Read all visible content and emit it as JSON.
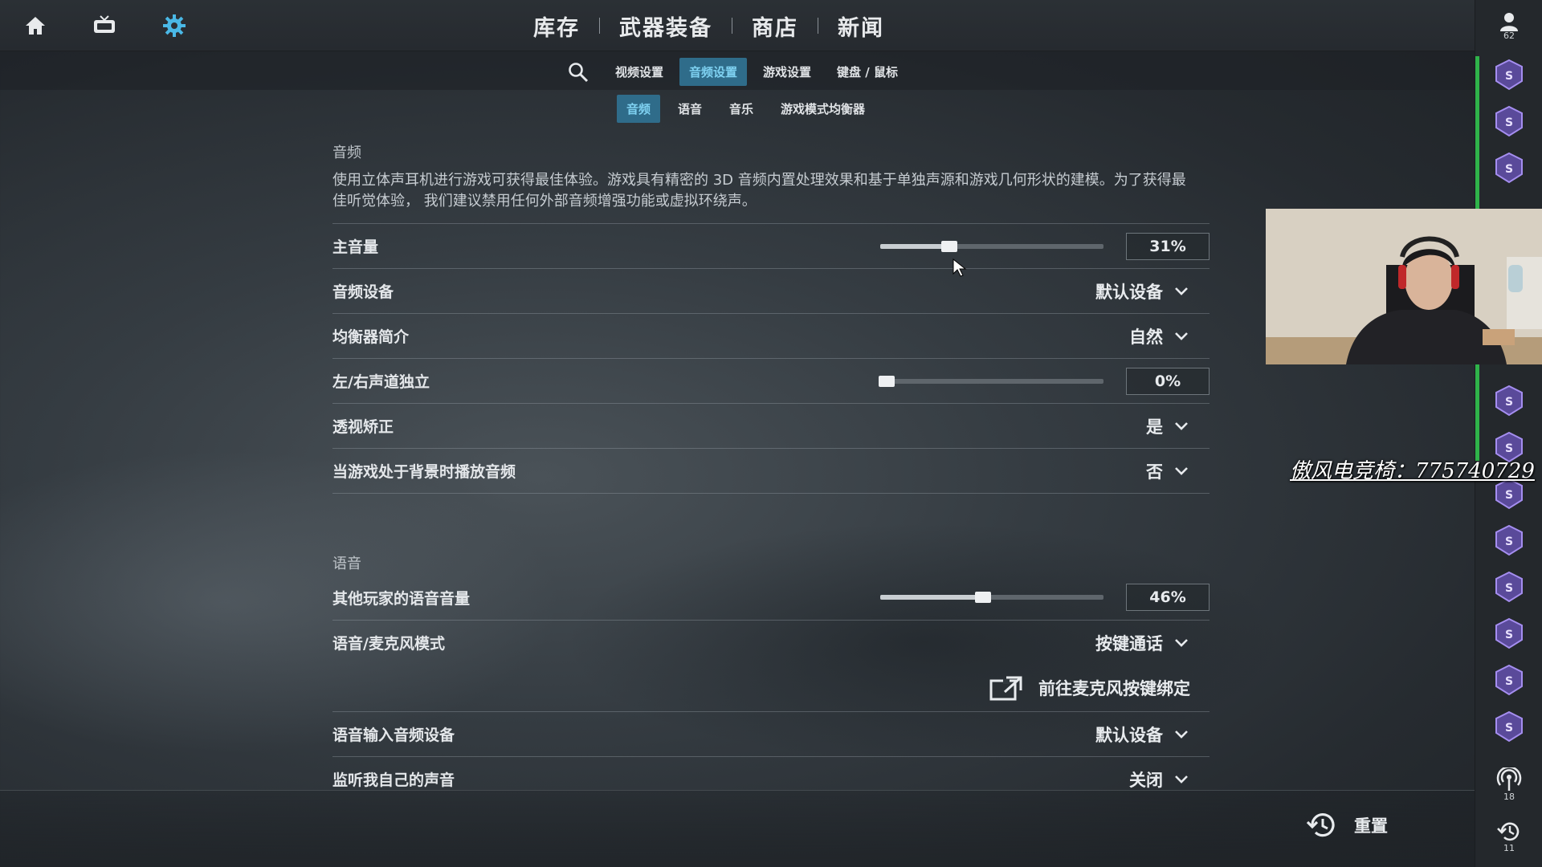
{
  "nav": {
    "main_tabs": [
      "库存",
      "武器装备",
      "商店",
      "新闻"
    ],
    "sub_tabs": [
      "视频设置",
      "音频设置",
      "游戏设置",
      "键盘 / 鼠标"
    ],
    "sub_active": "音频设置",
    "tertiary_tabs": [
      "音频",
      "语音",
      "音乐",
      "游戏模式均衡器"
    ],
    "tertiary_active": "音频"
  },
  "audio": {
    "section_title": "音频",
    "description": "使用立体声耳机进行游戏可获得最佳体验。游戏具有精密的 3D 音频内置处理效果和基于单独声源和游戏几何形状的建模。为了获得最佳听觉体验， 我们建议禁用任何外部音频增强功能或虚拟环绕声。",
    "master_volume": {
      "label": "主音量",
      "value": 31,
      "display": "31%"
    },
    "device": {
      "label": "音频设备",
      "value": "默认设备"
    },
    "eq_profile": {
      "label": "均衡器简介",
      "value": "自然"
    },
    "lr_isolation": {
      "label": "左/右声道独立",
      "value": 0,
      "display": "0%"
    },
    "perspective": {
      "label": "透视矫正",
      "value": "是"
    },
    "background_audio": {
      "label": "当游戏处于背景时播放音频",
      "value": "否"
    }
  },
  "voice": {
    "section_title": "语音",
    "others_volume": {
      "label": "其他玩家的语音音量",
      "value": 46,
      "display": "46%"
    },
    "mic_mode": {
      "label": "语音/麦克风模式",
      "value": "按键通话"
    },
    "bind_link": "前往麦克风按键绑定",
    "input_device": {
      "label": "语音输入音频设备",
      "value": "默认设备"
    },
    "monitor": {
      "label": "监听我自己的声音",
      "value": "关闭"
    }
  },
  "footer": {
    "reset_label": "重置"
  },
  "rail": {
    "friends_count": "62",
    "broadcast_count": "18",
    "history_count": "11"
  },
  "overlay": {
    "watermark": "傲风电竞椅：775740729"
  },
  "colors": {
    "accent": "#2f6c8a",
    "accent_text": "#7fd2f2",
    "online": "#2fb34a",
    "badge": "#8a6fd1"
  }
}
